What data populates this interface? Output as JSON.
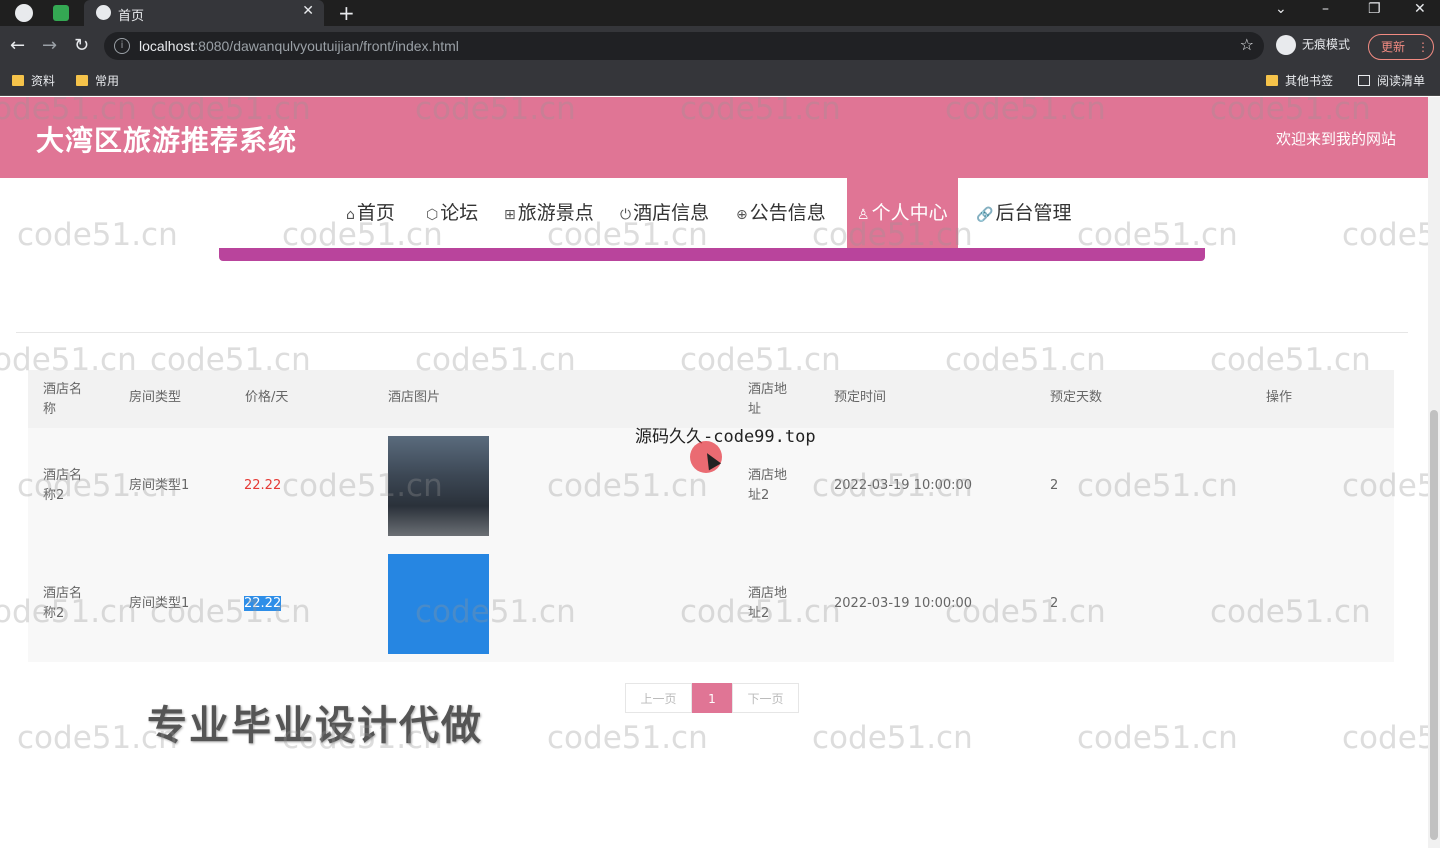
{
  "browser": {
    "tab_title": "首页",
    "new_tab": "+",
    "url_host": "localhost",
    "url_path": ":8080/dawanqulvyoutuijian/front/index.html",
    "incognito_label": "无痕模式",
    "update_label": "更新",
    "bookmarks": [
      "资料",
      "常用"
    ],
    "bookmarks_right": [
      "其他书签",
      "阅读清单"
    ],
    "win_controls": [
      "⌄",
      "–",
      "❐",
      "✕"
    ]
  },
  "site": {
    "title": "大湾区旅游推荐系统",
    "welcome": "欢迎来到我的网站"
  },
  "nav": {
    "items": [
      {
        "icon": "⌂",
        "label": "首页"
      },
      {
        "icon": "⬡",
        "label": "论坛"
      },
      {
        "icon": "⊞",
        "label": "旅游景点"
      },
      {
        "icon": "⏻",
        "label": "酒店信息"
      },
      {
        "icon": "⊕",
        "label": "公告信息"
      },
      {
        "icon": "♙",
        "label": "个人中心"
      },
      {
        "icon": "🔗",
        "label": "后台管理"
      }
    ],
    "active": "个人中心"
  },
  "table": {
    "headers": [
      "酒店名称",
      "房间类型",
      "价格/天",
      "酒店图片",
      "酒店地址",
      "预定时间",
      "预定天数",
      "操作"
    ],
    "rows": [
      {
        "hotel_name": "酒店名称2",
        "room_type": "房间类型1",
        "price": "22.22",
        "address": "酒店地址2",
        "booking_time": "2022-03-19 10:00:00",
        "days": "2"
      },
      {
        "hotel_name": "酒店名称2",
        "room_type": "房间类型1",
        "price": "22.22",
        "address": "酒店地址2",
        "booking_time": "2022-03-19 10:00:00",
        "days": "2"
      }
    ]
  },
  "pager": {
    "prev": "上一页",
    "current": "1",
    "next": "下一页"
  },
  "overlay": {
    "code_text": "源码久久-code99.top",
    "ad_text": "专业毕业设计代做",
    "watermark": "code51.cn"
  },
  "colors": {
    "brand_pink": "#e07595",
    "accent_purple": "#b9449c",
    "price_red": "#e53935"
  }
}
